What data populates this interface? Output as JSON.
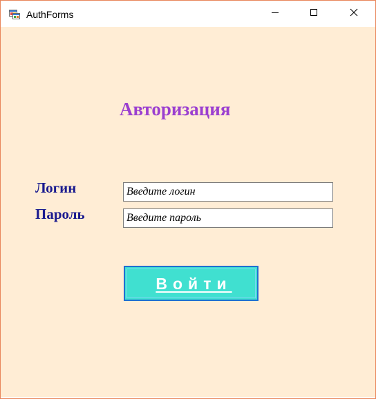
{
  "window": {
    "title": "AuthForms",
    "app_icon": "winforms-app-icon",
    "controls": {
      "minimize_icon": "minimize-icon",
      "maximize_icon": "maximize-icon",
      "close_icon": "close-icon"
    }
  },
  "form": {
    "heading": "Авторизация",
    "login_label": "Логин",
    "login_placeholder": "Введите логин",
    "login_value": "",
    "password_label": "Пароль",
    "password_placeholder": "Введите пароль",
    "password_value": "",
    "submit_label": "Войти"
  },
  "colors": {
    "background": "#ffedd5",
    "heading": "#9b3fd0",
    "labels": "#1b1b8f",
    "button_fill": "#40e0d0",
    "button_border": "#1f6fd1",
    "button_text": "#ffffff",
    "window_border": "#e8855a"
  }
}
